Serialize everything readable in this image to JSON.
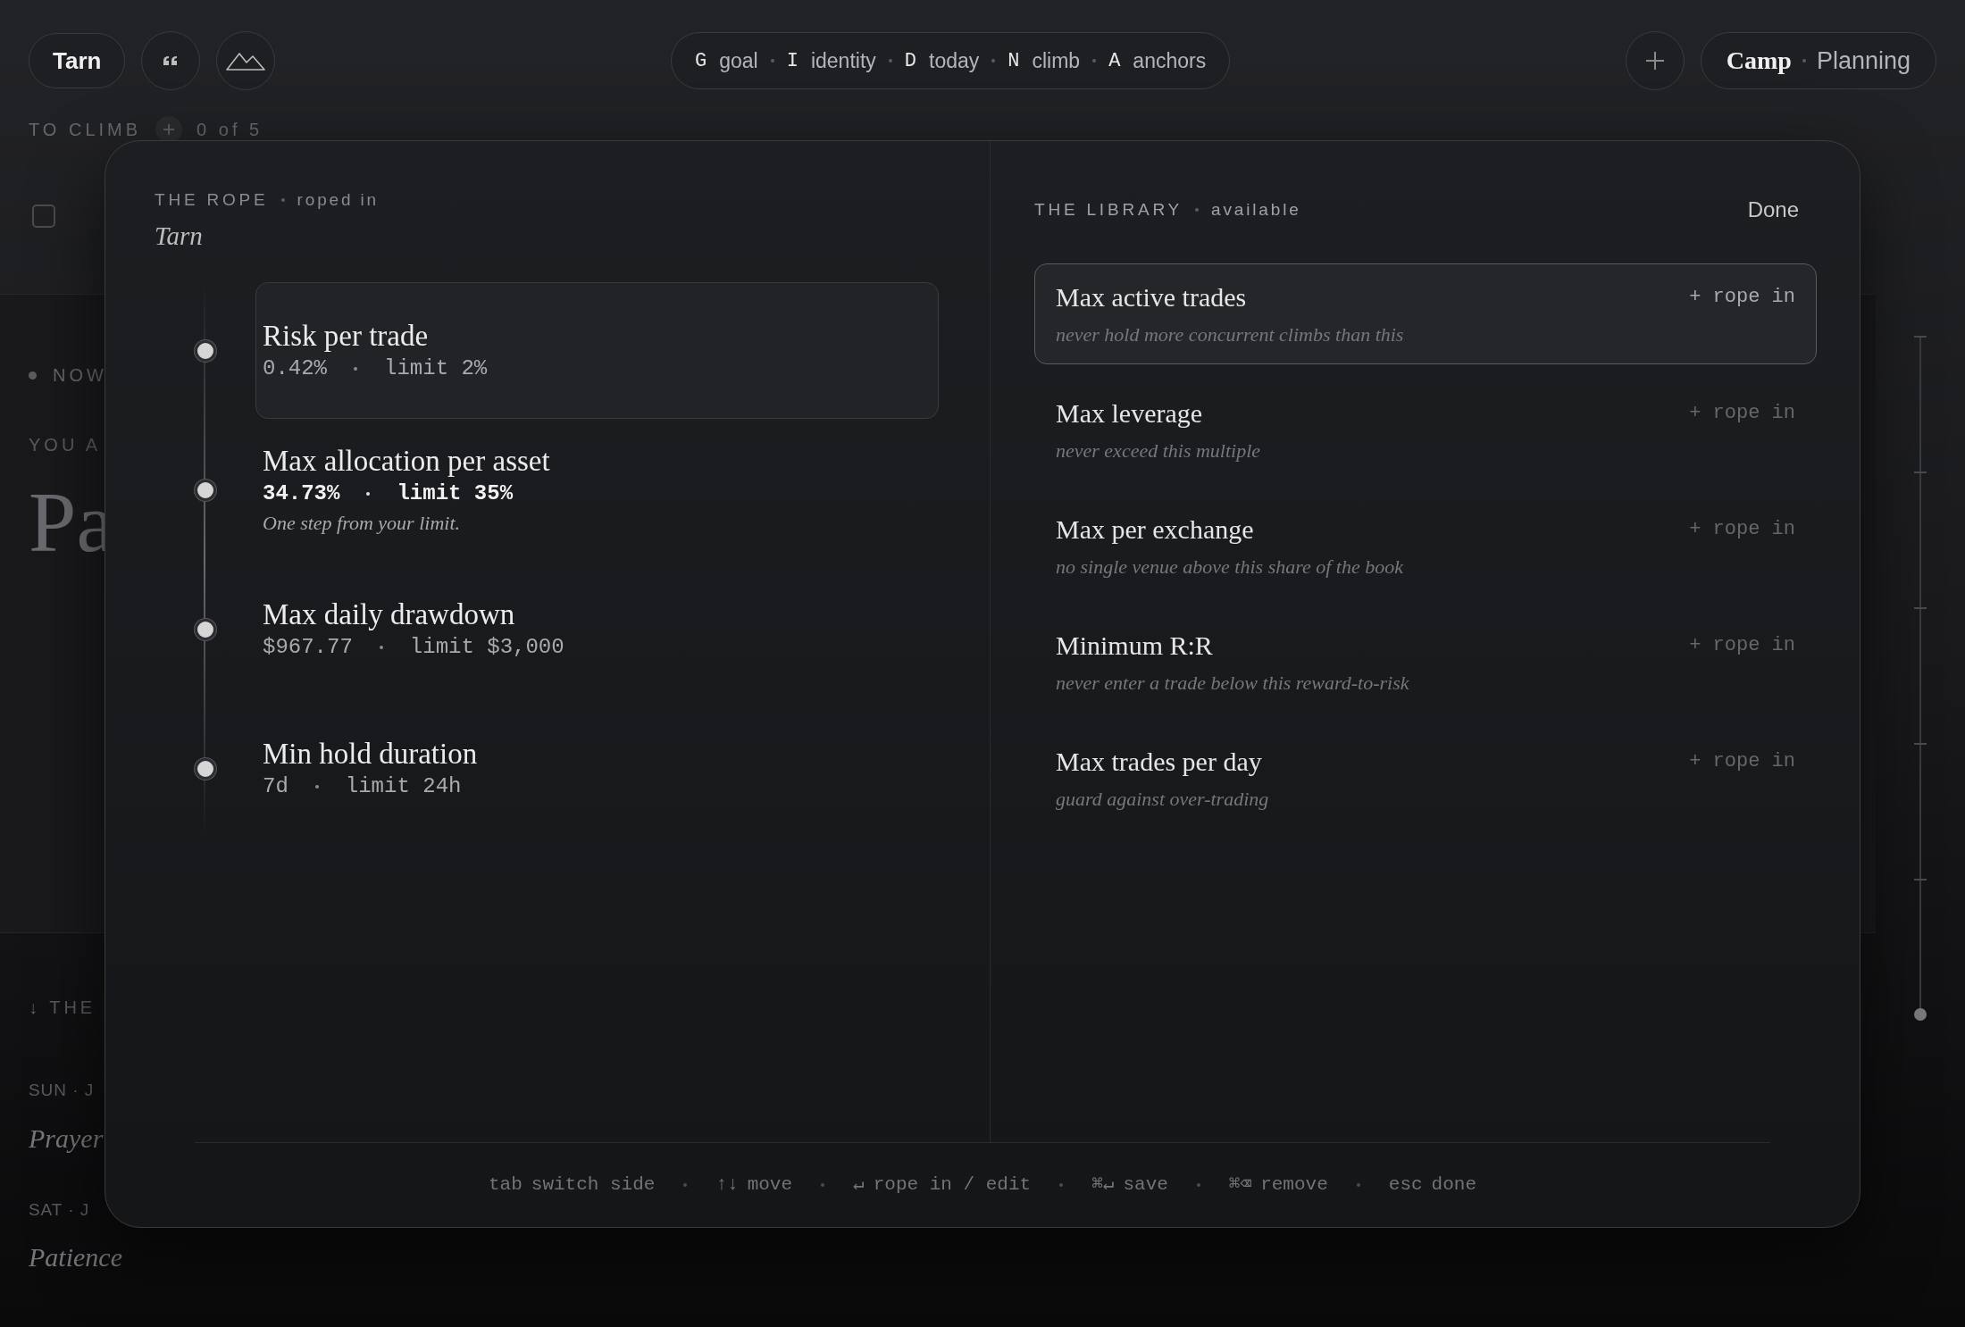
{
  "top_bar": {
    "profile": "Tarn",
    "shortcuts": [
      {
        "key": "G",
        "label": "goal"
      },
      {
        "key": "I",
        "label": "identity"
      },
      {
        "key": "D",
        "label": "today"
      },
      {
        "key": "N",
        "label": "climb"
      },
      {
        "key": "A",
        "label": "anchors"
      }
    ],
    "modes": [
      {
        "label": "Camp",
        "selected": true
      },
      {
        "label": "Planning",
        "selected": false
      }
    ]
  },
  "background": {
    "to_climb": {
      "label": "TO CLIMB",
      "count": "0 of 5"
    },
    "task": {
      "checked": false
    },
    "now": "NOW",
    "you_are": "YOU A",
    "title": "Pa",
    "section": "↓ THE",
    "entries": [
      {
        "date": "SUN · J",
        "title": "Prayer"
      },
      {
        "date": "SAT · J",
        "title": "Patience"
      }
    ]
  },
  "rope": {
    "heading": "THE ROPE",
    "status": "roped in",
    "name": "Tarn",
    "items": [
      {
        "title": "Risk per trade",
        "value": "0.42%",
        "limit": "limit 2%",
        "near_limit": false,
        "selected": true
      },
      {
        "title": "Max allocation per asset",
        "value": "34.73%",
        "limit": "limit 35%",
        "note": "One step from your limit.",
        "near_limit": true,
        "selected": false
      },
      {
        "title": "Max daily drawdown",
        "value": "$967.77",
        "limit": "limit $3,000",
        "near_limit": false,
        "selected": false
      },
      {
        "title": "Min hold duration",
        "value": "7d",
        "limit": "limit 24h",
        "near_limit": false,
        "selected": false
      }
    ]
  },
  "library": {
    "heading": "THE LIBRARY",
    "status": "available",
    "done": "Done",
    "items": [
      {
        "title": "Max active trades",
        "description": "never hold more concurrent climbs than this",
        "action": "+ rope in",
        "selected": true
      },
      {
        "title": "Max leverage",
        "description": "never exceed this multiple",
        "action": "+ rope in",
        "selected": false
      },
      {
        "title": "Max per exchange",
        "description": "no single venue above this share of the book",
        "action": "+ rope in",
        "selected": false
      },
      {
        "title": "Minimum R:R",
        "description": "never enter a trade below this reward-to-risk",
        "action": "+ rope in",
        "selected": false
      },
      {
        "title": "Max trades per day",
        "description": "guard against over-trading",
        "action": "+ rope in",
        "selected": false
      }
    ]
  },
  "footer_hints": [
    {
      "key": "tab",
      "label": "switch side"
    },
    {
      "key": "↑↓",
      "label": "move"
    },
    {
      "key": "↵",
      "label": "rope in / edit"
    },
    {
      "key": "⌘↵",
      "label": "save"
    },
    {
      "key": "⌘⌫",
      "label": "remove"
    },
    {
      "key": "esc",
      "label": "done"
    }
  ]
}
